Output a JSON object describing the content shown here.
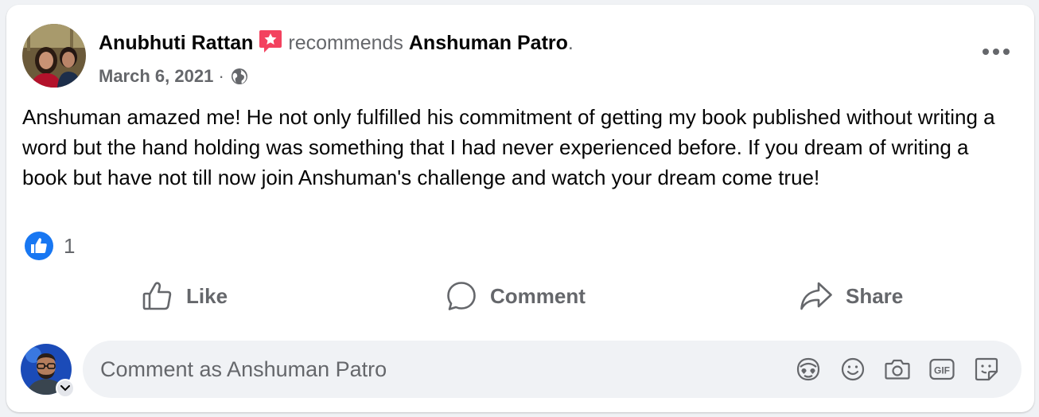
{
  "post": {
    "author": "Anubhuti Rattan",
    "verb": "recommends",
    "target": "Anshuman Patro",
    "target_suffix": ".",
    "date": "March 6, 2021",
    "separator": "·",
    "audience_icon": "globe-icon",
    "body": "Anshuman amazed me! He not only fulfilled his commitment of getting my book published without writing a word but the hand holding was something that I had never experienced before. If you dream of writing a book but have not till now join Anshuman's challenge and watch your dream come true!",
    "reaction_count": "1",
    "reaction_icon": "like-reaction-icon"
  },
  "actions": {
    "like_label": "Like",
    "comment_label": "Comment",
    "share_label": "Share"
  },
  "composer": {
    "placeholder": "Comment as Anshuman Patro",
    "icons": [
      "avatar-sticker-icon",
      "emoji-icon",
      "camera-icon",
      "gif-icon",
      "sticker-icon"
    ]
  },
  "colors": {
    "text_primary": "#050505",
    "text_secondary": "#65676b",
    "like_blue": "#1877f2",
    "recommend_badge": "#f3425f",
    "card_bg": "#ffffff",
    "page_bg": "#f0f2f5"
  }
}
